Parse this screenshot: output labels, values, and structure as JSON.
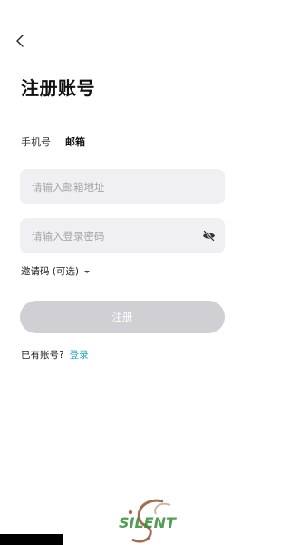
{
  "page": {
    "title": "注册账号"
  },
  "tabs": [
    {
      "label": "手机号",
      "active": false
    },
    {
      "label": "邮箱",
      "active": true
    }
  ],
  "form": {
    "email_placeholder": "请输入邮箱地址",
    "password_placeholder": "请输入登录密码",
    "invite_label": "邀请码 (可选)",
    "register_label": "注册"
  },
  "footer": {
    "have_account": "已有账号?",
    "login_label": "登录"
  },
  "watermark": {
    "text": "SILENT"
  },
  "icons": {
    "back": "chevron-left-icon",
    "password_toggle": "eye-off-icon",
    "invite_toggle": "caret-down-icon"
  },
  "colors": {
    "accent": "#2aa4b8",
    "field_bg": "#f0f0f2",
    "button_disabled": "#cfcfd4",
    "watermark_green": "#3a8a3a",
    "watermark_brown": "#8a4a2a"
  }
}
